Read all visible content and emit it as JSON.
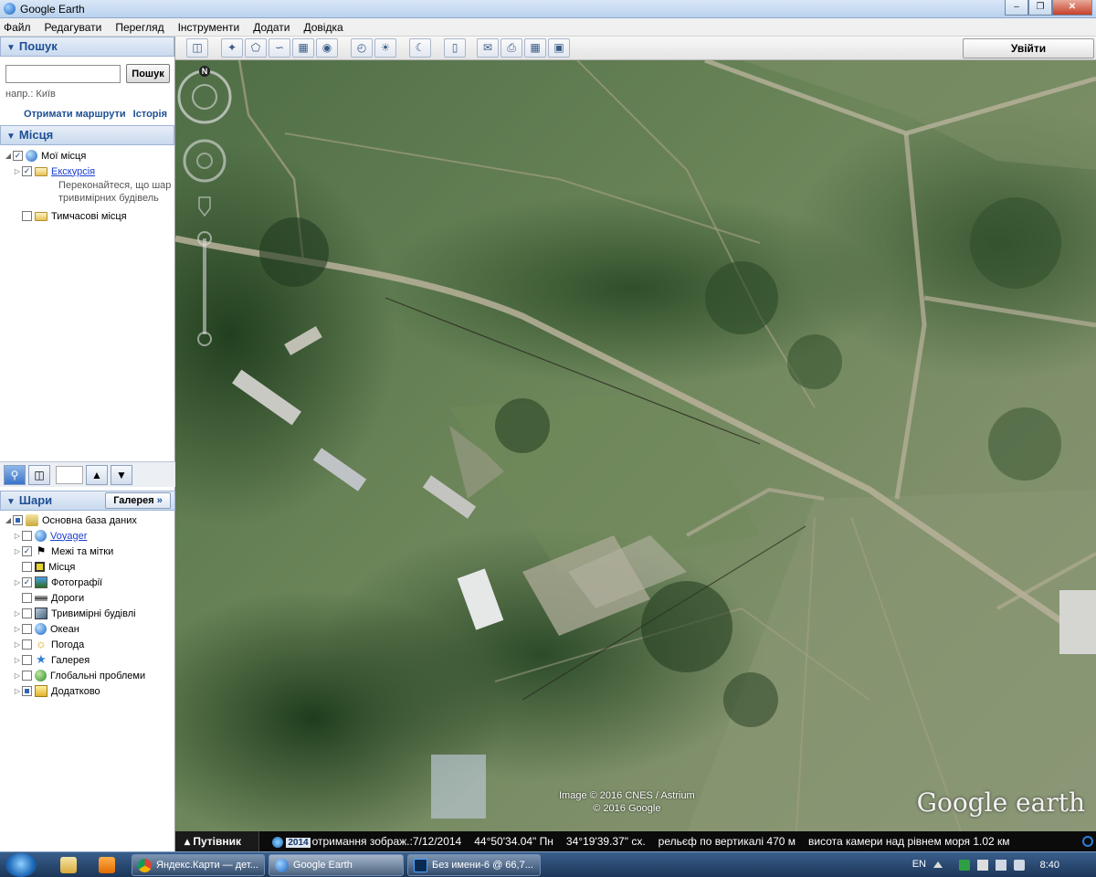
{
  "window": {
    "title": "Google Earth",
    "min": "0",
    "max": "1",
    "close": "r"
  },
  "menu": [
    "Файл",
    "Редагувати",
    "Перегляд",
    "Інструменти",
    "Додати",
    "Довідка"
  ],
  "search": {
    "header": "Пошук",
    "input_value": "",
    "button": "Пошук",
    "hint": "напр.: Київ",
    "link_routes": "Отримати маршрути",
    "link_history": "Історія"
  },
  "places": {
    "header": "Місця",
    "my_places": "Мої місця",
    "tour": "Екскурсія",
    "tour_note_1": "Переконайтеся, що шар",
    "tour_note_2": "тривимірних будівель",
    "temp_places": "Тимчасові місця"
  },
  "layers": {
    "header": "Шари",
    "gallery_button": "Галерея",
    "primary_db": "Основна база даних",
    "items": [
      {
        "label": "Voyager",
        "checked": false,
        "link": true
      },
      {
        "label": "Межі та мітки",
        "checked": true
      },
      {
        "label": "Місця",
        "checked": false
      },
      {
        "label": "Фотографії",
        "checked": true
      },
      {
        "label": "Дороги",
        "checked": false
      },
      {
        "label": "Тривимірні будівлі",
        "checked": false
      },
      {
        "label": "Океан",
        "checked": false
      },
      {
        "label": "Погода",
        "checked": false
      },
      {
        "label": "Галерея",
        "checked": false
      },
      {
        "label": "Глобальні проблеми",
        "checked": false
      },
      {
        "label": "Додатково",
        "checked": false
      }
    ]
  },
  "toolbar": {
    "signin": "Увійти"
  },
  "map": {
    "credit_1": "Image © 2016 CNES / Astrium",
    "credit_2": "© 2016 Google",
    "logo": "Google earth",
    "compass_n": "N"
  },
  "status": {
    "tour_button": "Путівник",
    "year": "2014",
    "imagery_date": "отримання зображ.:7/12/2014",
    "lat": "44°50'34.04\" Пн",
    "lon": "34°19'39.37\" сх.",
    "elevation": "рельєф по вертикалі   470 м",
    "eye_alt": "висота камери над рівнем моря   1.02 км"
  },
  "taskbar": {
    "tasks": [
      "Яндекс.Карти — дет...",
      "Google Earth",
      "Без имени-6 @ 66,7..."
    ],
    "lang": "EN",
    "clock": "8:40"
  },
  "colors": {
    "accent": "#1d4f95",
    "link": "#1a3fd1",
    "taskbar": "#1c3658"
  }
}
